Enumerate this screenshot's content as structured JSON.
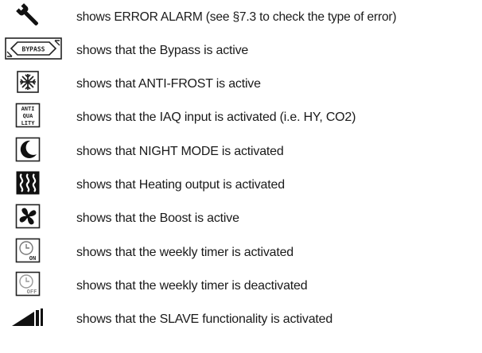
{
  "legend": [
    {
      "icon": "wrench-icon",
      "text": "shows ERROR ALARM (see §7.3 to check the type of error)"
    },
    {
      "icon": "bypass-icon",
      "icon_text": "BYPASS",
      "text": "shows that the Bypass is active"
    },
    {
      "icon": "snowflake-icon",
      "text": "shows that ANTI-FROST is active"
    },
    {
      "icon": "iaq-icon",
      "icon_text": [
        "ANTI",
        "QUA",
        "LITY"
      ],
      "text": "shows that the IAQ input is activated (i.e. HY, CO2)"
    },
    {
      "icon": "moon-icon",
      "text": "shows that NIGHT MODE is activated"
    },
    {
      "icon": "heating-icon",
      "text": "shows that Heating output is activated"
    },
    {
      "icon": "fan-icon",
      "text": "shows that the Boost is active"
    },
    {
      "icon": "weekly-timer-on-icon",
      "icon_text": "ON",
      "text": "shows that the weekly timer is activated"
    },
    {
      "icon": "weekly-timer-off-icon",
      "icon_text": "OFF",
      "text": "shows that the weekly timer is deactivated"
    },
    {
      "icon": "slave-signal-icon",
      "text": "shows that the SLAVE functionality is activated"
    }
  ]
}
